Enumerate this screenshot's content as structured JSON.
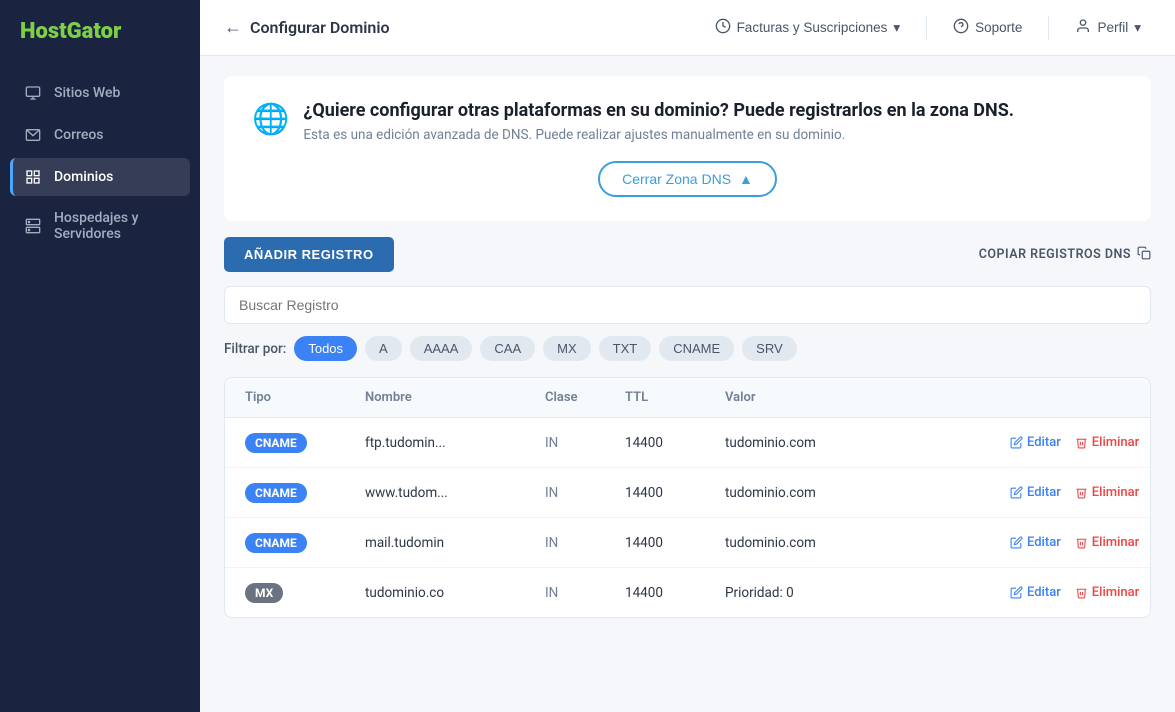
{
  "sidebar": {
    "logo_line1": "Host",
    "logo_line2": "Gator",
    "items": [
      {
        "id": "sitios-web",
        "label": "Sitios Web",
        "icon": "monitor"
      },
      {
        "id": "correos",
        "label": "Correos",
        "icon": "mail"
      },
      {
        "id": "dominios",
        "label": "Dominios",
        "icon": "grid",
        "active": true
      },
      {
        "id": "hospedajes",
        "label": "Hospedajes y Servidores",
        "icon": "server"
      }
    ]
  },
  "topnav": {
    "back_label": "Configurar Dominio",
    "billing_label": "Facturas y Suscripciones",
    "support_label": "Soporte",
    "profile_label": "Perfil"
  },
  "banner": {
    "title": "¿Quiere configurar otras plataformas en su dominio? Puede registrarlos en la zona DNS.",
    "subtitle": "Esta es una edición avanzada de DNS. Puede realizar ajustes manualmente en su dominio.",
    "close_label": "Cerrar Zona DNS"
  },
  "toolbar": {
    "add_label": "AÑADIR REGISTRO",
    "copy_label": "COPIAR REGISTROS DNS"
  },
  "search": {
    "placeholder": "Buscar Registro"
  },
  "filter": {
    "label": "Filtrar por:",
    "options": [
      {
        "id": "todos",
        "label": "Todos",
        "active": true
      },
      {
        "id": "a",
        "label": "A",
        "active": false
      },
      {
        "id": "aaaa",
        "label": "AAAA",
        "active": false
      },
      {
        "id": "caa",
        "label": "CAA",
        "active": false
      },
      {
        "id": "mx",
        "label": "MX",
        "active": false
      },
      {
        "id": "txt",
        "label": "TXT",
        "active": false
      },
      {
        "id": "cname",
        "label": "CNAME",
        "active": false
      },
      {
        "id": "srv",
        "label": "SRV",
        "active": false
      }
    ]
  },
  "table": {
    "headers": [
      "Tipo",
      "Nombre",
      "Clase",
      "TTL",
      "Valor",
      ""
    ],
    "rows": [
      {
        "type": "CNAME",
        "type_color": "cname",
        "name": "ftp.tudomin...",
        "clase": "IN",
        "ttl": "14400",
        "valor": "tudominio.com",
        "edit_label": "Editar",
        "delete_label": "Eliminar"
      },
      {
        "type": "CNAME",
        "type_color": "cname",
        "name": "www.tudom...",
        "clase": "IN",
        "ttl": "14400",
        "valor": "tudominio.com",
        "edit_label": "Editar",
        "delete_label": "Eliminar"
      },
      {
        "type": "CNAME",
        "type_color": "cname",
        "name": "mail.tudomin",
        "clase": "IN",
        "ttl": "14400",
        "valor": "tudominio.com",
        "edit_label": "Editar",
        "delete_label": "Eliminar"
      },
      {
        "type": "MX",
        "type_color": "mx",
        "name": "tudominio.co",
        "clase": "IN",
        "ttl": "14400",
        "valor": "Prioridad: 0",
        "edit_label": "Editar",
        "delete_label": "Eliminar"
      }
    ]
  }
}
